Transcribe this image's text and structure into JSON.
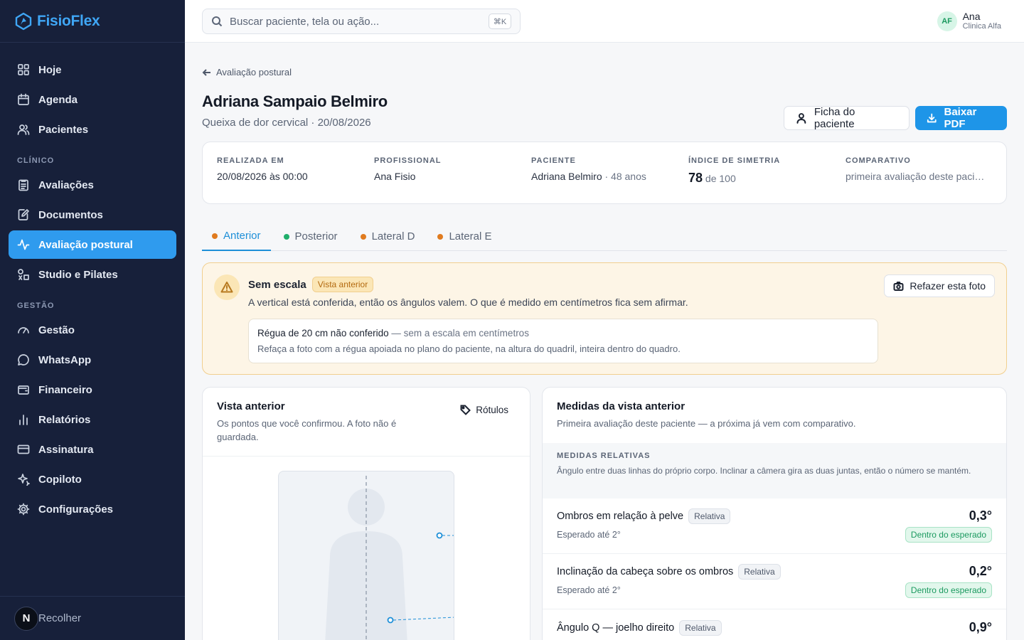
{
  "brand": {
    "name": "FisioFlex"
  },
  "sidebar": {
    "items_top": [
      {
        "label": "Hoje",
        "icon": "grid-icon"
      },
      {
        "label": "Agenda",
        "icon": "calendar-icon"
      },
      {
        "label": "Pacientes",
        "icon": "users-icon"
      }
    ],
    "section_clinico": "CLÍNICO",
    "items_clinico": [
      {
        "label": "Avaliações",
        "icon": "clipboard-icon"
      },
      {
        "label": "Documentos",
        "icon": "document-edit-icon"
      },
      {
        "label": "Avaliação postural",
        "icon": "activity-icon",
        "active": true
      },
      {
        "label": "Studio e Pilates",
        "icon": "shapes-icon"
      }
    ],
    "section_gestao": "GESTÃO",
    "items_gestao": [
      {
        "label": "Gestão",
        "icon": "gauge-icon"
      },
      {
        "label": "WhatsApp",
        "icon": "chat-icon"
      },
      {
        "label": "Financeiro",
        "icon": "wallet-icon"
      },
      {
        "label": "Relatórios",
        "icon": "bar-chart-icon"
      },
      {
        "label": "Assinatura",
        "icon": "credit-card-icon"
      },
      {
        "label": "Copiloto",
        "icon": "sparkles-icon"
      },
      {
        "label": "Configurações",
        "icon": "gear-icon"
      }
    ],
    "collapse_badge": "N",
    "collapse_label": "Recolher"
  },
  "topbar": {
    "search_placeholder": "Buscar paciente, tela ou ação...",
    "shortcut": "⌘K",
    "user_initials": "AF",
    "user_name": "Ana",
    "user_clinic": "Clinica Alfa"
  },
  "page": {
    "back_label": "Avaliação postural",
    "title": "Adriana Sampaio Belmiro",
    "subtitle": "Queixa de dor cervical · 20/08/2026",
    "btn_ficha": "Ficha do paciente",
    "btn_pdf": "Baixar PDF"
  },
  "info": {
    "realizada_label": "REALIZADA EM",
    "realizada_value": "20/08/2026 às 00:00",
    "profissional_label": "PROFISSIONAL",
    "profissional_value": "Ana Fisio",
    "paciente_label": "PACIENTE",
    "paciente_name": "Adriana Belmiro",
    "paciente_age": " · 48 anos",
    "indice_label": "ÍNDICE DE SIMETRIA",
    "indice_value": "78",
    "indice_total": " de 100",
    "comparativo_label": "COMPARATIVO",
    "comparativo_value": "primeira avaliação deste paciente"
  },
  "tabs": [
    {
      "label": "Anterior",
      "dot_color": "#e07b1f",
      "active": true
    },
    {
      "label": "Posterior",
      "dot_color": "#1fae6b"
    },
    {
      "label": "Lateral D",
      "dot_color": "#e07b1f"
    },
    {
      "label": "Lateral E",
      "dot_color": "#e07b1f"
    }
  ],
  "warning": {
    "title": "Sem escala",
    "badge": "Vista anterior",
    "text": "A vertical está conferida, então os ângulos valem. O que é medido em centímetros fica sem afirmar.",
    "box_strong": "Régua de 20 cm não conferido",
    "box_muted": " — sem a escala em centímetros",
    "box_hint": "Refaça a foto com a régua apoiada no plano do paciente, na altura do quadril, inteira dentro do quadro.",
    "redo_label": "Refazer esta foto"
  },
  "view_card": {
    "title": "Vista anterior",
    "subtitle": "Os pontos que você confirmou. A foto não é guardada.",
    "labels_btn": "Rótulos"
  },
  "measures_card": {
    "title": "Medidas da vista anterior",
    "subtitle": "Primeira avaliação deste paciente — a próxima já vem com comparativo.",
    "section_label": "MEDIDAS RELATIVAS",
    "section_desc": "Ângulo entre duas linhas do próprio corpo. Inclinar a câmera gira as duas juntas, então o número se mantém.",
    "items": [
      {
        "name": "Ombros em relação à pelve",
        "pill": "Relativa",
        "expected": "Esperado até 2°",
        "value": "0,3°",
        "status": "Dentro do esperado"
      },
      {
        "name": "Inclinação da cabeça sobre os ombros",
        "pill": "Relativa",
        "expected": "Esperado até 2°",
        "value": "0,2°",
        "status": "Dentro do esperado"
      },
      {
        "name": "Ângulo Q — joelho direito",
        "pill": "Relativa",
        "expected": "",
        "value": "0,9°",
        "status": ""
      }
    ]
  },
  "colors": {
    "accent": "#1e95e8",
    "sidebar_bg": "#17203a",
    "warning_bg": "#fdf5e6",
    "ok_green": "#1c9a60"
  }
}
